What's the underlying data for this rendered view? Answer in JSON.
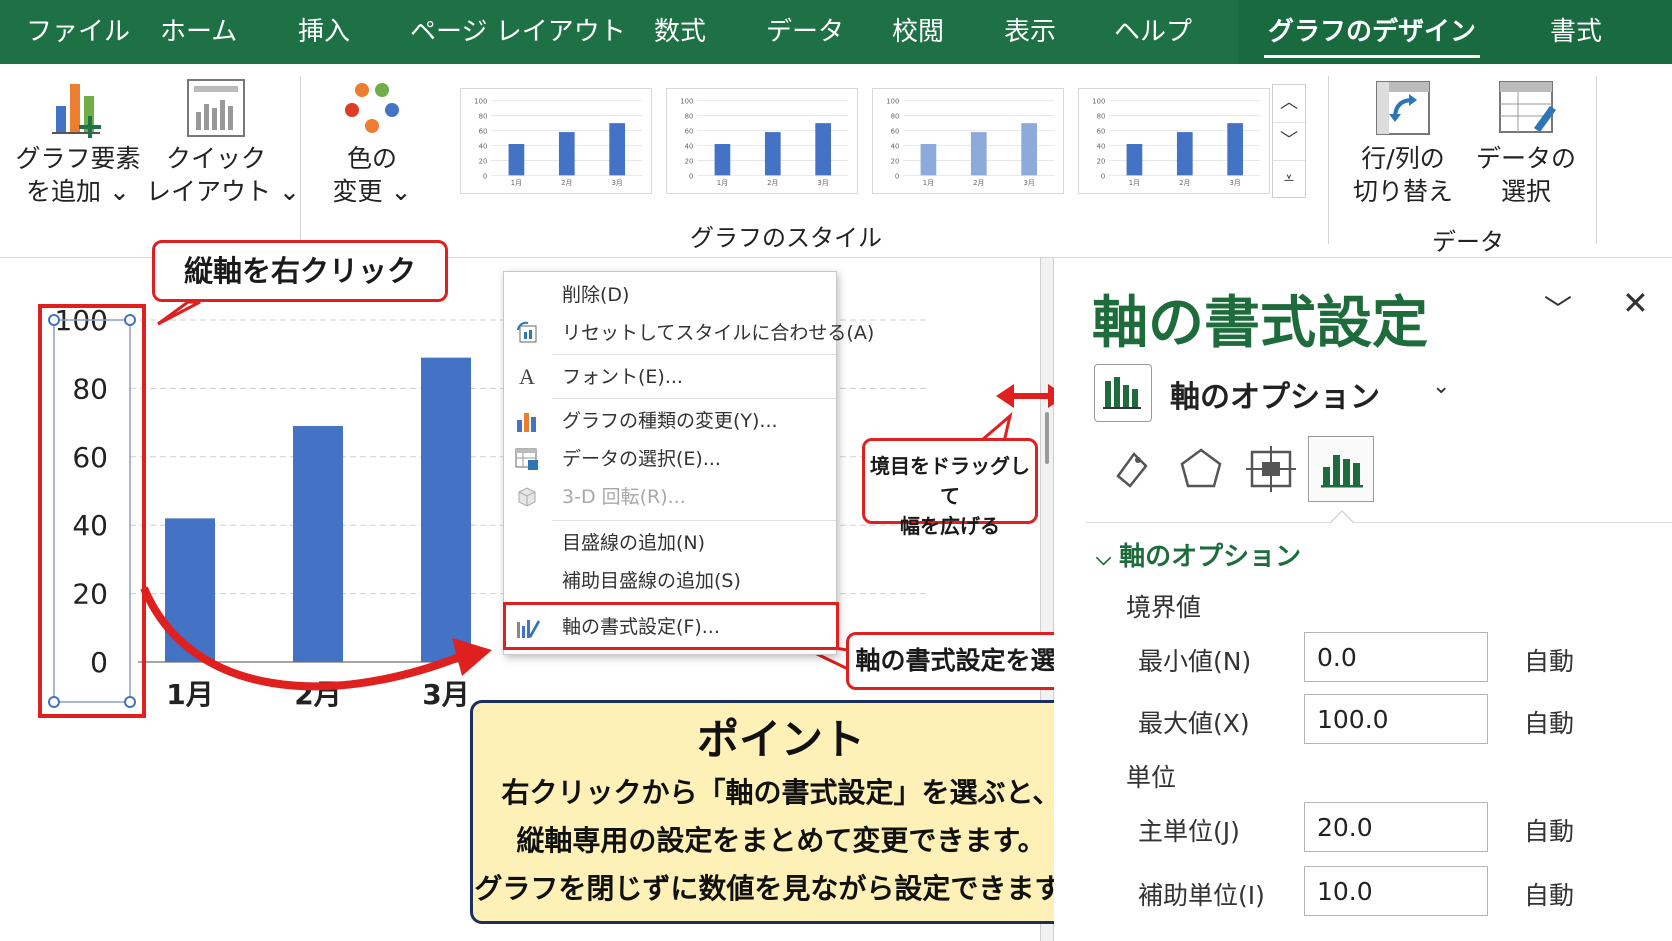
{
  "menubar": {
    "tabs": [
      "ファイル",
      "ホーム",
      "挿入",
      "ページ レイアウト",
      "数式",
      "データ",
      "校閲",
      "表示",
      "ヘルプ",
      "グラフのデザイン",
      "書式"
    ],
    "active_tab": "グラフのデザイン"
  },
  "ribbon": {
    "add_element": [
      "グラフ要素",
      "を追加 ⌄"
    ],
    "quick_layout": [
      "クイック",
      "レイアウト ⌄"
    ],
    "color_change": [
      "色の",
      "変更 ⌄"
    ],
    "styles_group_label": "グラフのスタイル",
    "switch_row_col": [
      "行/列の",
      "切り替え"
    ],
    "select_data": [
      "データの",
      "選択"
    ],
    "data_group_label": "データ",
    "style_thumbnails": [
      {
        "y_ticks": [
          "100",
          "80",
          "60",
          "40",
          "20",
          "0"
        ],
        "x_ticks": [
          "1月",
          "2月",
          "3月"
        ],
        "values": [
          42,
          58,
          70
        ],
        "color": "#4472c4"
      },
      {
        "y_ticks": [
          "100",
          "80",
          "60",
          "40",
          "20",
          "0"
        ],
        "x_ticks": [
          "1月",
          "2月",
          "3月"
        ],
        "values": [
          42,
          58,
          70
        ],
        "color": "#4472c4"
      },
      {
        "y_ticks": [
          "100",
          "80",
          "60",
          "40",
          "20",
          "0"
        ],
        "x_ticks": [
          "1月",
          "2月",
          "3月"
        ],
        "values": [
          42,
          58,
          70
        ],
        "color": "#8eaadb"
      },
      {
        "y_ticks": [
          "100",
          "80",
          "60",
          "40",
          "20",
          "0"
        ],
        "x_ticks": [
          "1月",
          "2月",
          "3月"
        ],
        "values": [
          42,
          58,
          70
        ],
        "color": "#4472c4"
      }
    ]
  },
  "chart_data": {
    "type": "bar",
    "categories": [
      "1月",
      "2月",
      "3月"
    ],
    "values": [
      42,
      69,
      89
    ],
    "y_ticks": [
      "100",
      "80",
      "60",
      "40",
      "20",
      "0"
    ],
    "ylim": [
      0,
      100
    ],
    "grid": true,
    "bar_color": "#4472c4"
  },
  "annotations": {
    "right_click_axis": "縦軸を右クリック",
    "select_format_axis": "軸の書式設定を選択",
    "drag_hint": [
      "境目をドラッグして",
      "幅を広げる"
    ],
    "point_title": "ポイント",
    "point_lines": [
      "右クリックから「軸の書式設定」を選ぶと、",
      "縦軸専用の設定をまとめて変更できます。",
      "グラフを閉じずに数値を見ながら設定できます。"
    ],
    "highlight_color": "#e01f1f"
  },
  "context_menu": {
    "items": [
      {
        "label": "削除(D)",
        "icon": "none",
        "disabled": false
      },
      {
        "label": "リセットしてスタイルに合わせる(A)",
        "icon": "reset-style-icon",
        "disabled": false
      },
      {
        "label": "フォント(E)...",
        "icon": "font-icon",
        "disabled": false
      },
      {
        "label": "グラフの種類の変更(Y)...",
        "icon": "chart-type-icon",
        "disabled": false
      },
      {
        "label": "データの選択(E)...",
        "icon": "select-data-icon",
        "disabled": false
      },
      {
        "label": "3-D 回転(R)...",
        "icon": "3d-rotation-icon",
        "disabled": true
      },
      {
        "label": "目盛線の追加(N)",
        "icon": "none",
        "disabled": false
      },
      {
        "label": "補助目盛線の追加(S)",
        "icon": "none",
        "disabled": false
      },
      {
        "label": "軸の書式設定(F)...",
        "icon": "format-axis-icon",
        "disabled": false
      }
    ]
  },
  "format_pane": {
    "title": "軸の書式設定",
    "options_dropdown": "軸のオプション",
    "section": "軸のオプション",
    "bounds_heading": "境界値",
    "min_label": "最小値(N)",
    "min_value": "0.0",
    "max_label": "最大値(X)",
    "max_value": "100.0",
    "units_heading": "単位",
    "major_label": "主単位(J)",
    "major_value": "20.0",
    "minor_label": "補助単位(I)",
    "minor_value": "10.0",
    "auto_label": "自動",
    "accent_color": "#1e6b3b"
  }
}
